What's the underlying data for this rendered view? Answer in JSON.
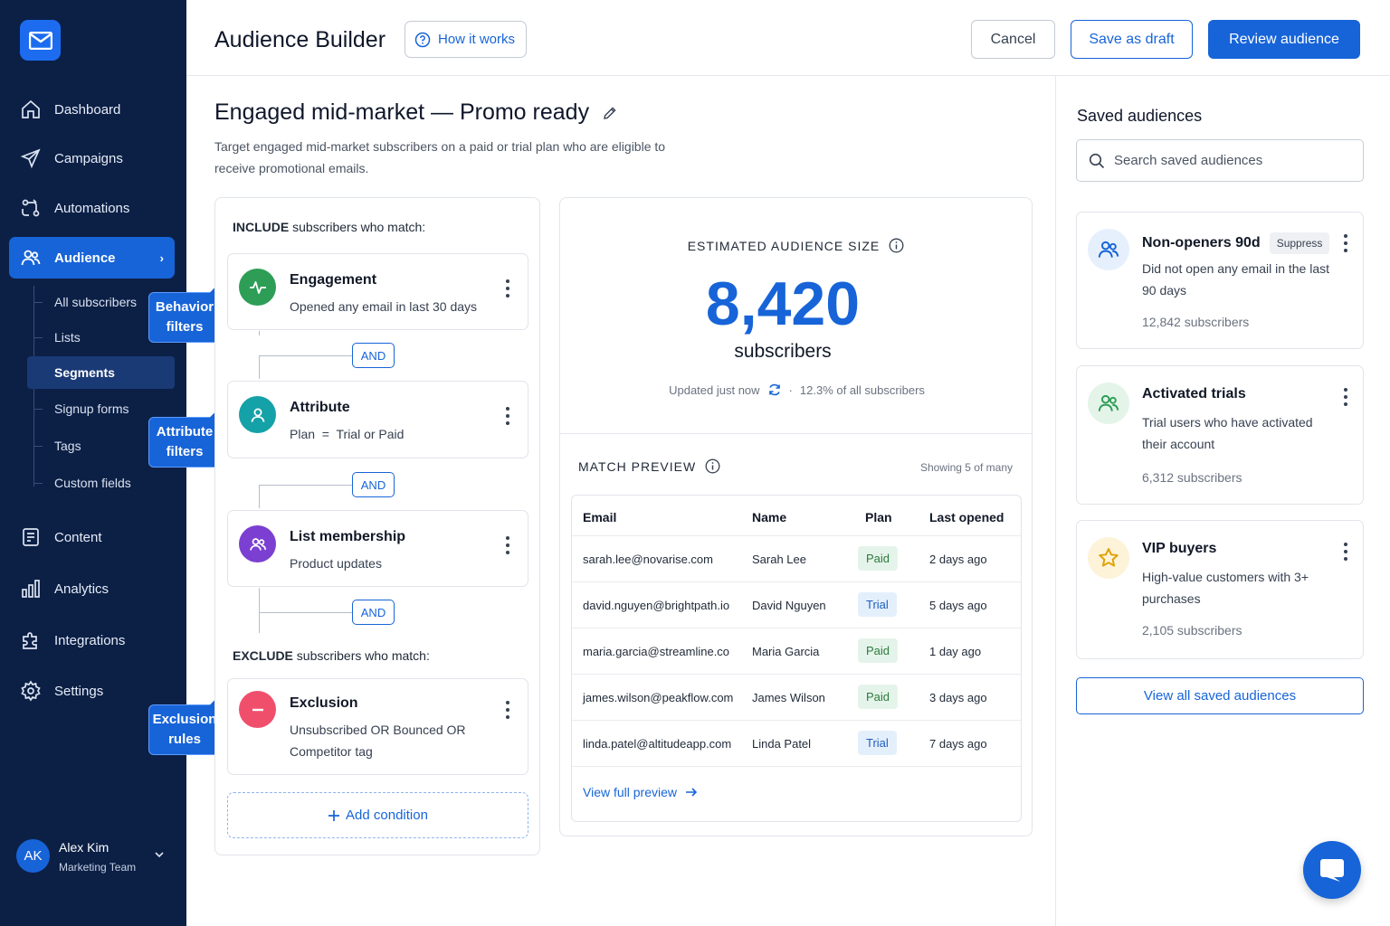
{
  "sidebar": {
    "nav": [
      {
        "label": "Dashboard",
        "icon": "home-icon"
      },
      {
        "label": "Campaigns",
        "icon": "send-icon"
      },
      {
        "label": "Automations",
        "icon": "automation-icon"
      },
      {
        "label": "Audience",
        "icon": "users-icon"
      },
      {
        "label": "Content",
        "icon": "document-icon"
      },
      {
        "label": "Analytics",
        "icon": "bar-chart-icon"
      },
      {
        "label": "Integrations",
        "icon": "puzzle-icon"
      },
      {
        "label": "Settings",
        "icon": "gear-icon"
      }
    ],
    "audience_sub": [
      "All subscribers",
      "Lists",
      "Segments",
      "Signup forms",
      "Tags",
      "Custom fields"
    ],
    "callouts": {
      "behavior": "Behavior filters",
      "attribute": "Attribute filters",
      "exclusion": "Exclusion rules"
    },
    "user": {
      "initials": "AK",
      "name": "Alex Kim",
      "team": "Marketing Team"
    }
  },
  "header": {
    "title": "Audience Builder",
    "how_it_works": "How it works",
    "cancel": "Cancel",
    "save_draft": "Save as draft",
    "review": "Review audience"
  },
  "segment": {
    "name": "Engaged mid-market — Promo ready",
    "description": "Target engaged mid-market subscribers on a paid or trial plan who are eligible to receive promotional emails."
  },
  "rules": {
    "include_label_bold": "INCLUDE",
    "include_label_rest": " subscribers who match:",
    "exclude_label_bold": "EXCLUDE",
    "exclude_label_rest": " subscribers who match:",
    "and_label": "AND",
    "include": [
      {
        "title": "Engagement",
        "desc": "Opened any email in last 30 days",
        "icon": "pulse-icon",
        "color": "#2e9e57"
      },
      {
        "title": "Attribute",
        "desc": "Plan  =  Trial or Paid",
        "icon": "person-icon",
        "color": "#15a1a8"
      },
      {
        "title": "List membership",
        "desc": "Product updates",
        "icon": "group-icon",
        "color": "#7b3fd1"
      }
    ],
    "exclude": [
      {
        "title": "Exclusion",
        "desc": "Unsubscribed OR Bounced OR Competitor tag",
        "icon": "minus-circle-icon",
        "color": "#f04f6c"
      }
    ],
    "add_condition": "Add condition"
  },
  "estimate": {
    "label": "ESTIMATED AUDIENCE SIZE",
    "value": "8,420",
    "unit": "subscribers",
    "updated": "Updated just now",
    "percent": "12.3% of all subscribers"
  },
  "preview": {
    "label": "MATCH PREVIEW",
    "showing": "Showing 5 of many",
    "columns": [
      "Email",
      "Name",
      "Plan",
      "Last opened"
    ],
    "rows": [
      {
        "email": "sarah.lee@novarise.com",
        "name": "Sarah Lee",
        "plan": "Paid",
        "last": "2 days ago"
      },
      {
        "email": "david.nguyen@brightpath.io",
        "name": "David Nguyen",
        "plan": "Trial",
        "last": "5 days ago"
      },
      {
        "email": "maria.garcia@streamline.co",
        "name": "Maria Garcia",
        "plan": "Paid",
        "last": "1 day ago"
      },
      {
        "email": "james.wilson@peakflow.com",
        "name": "James Wilson",
        "plan": "Paid",
        "last": "3 days ago"
      },
      {
        "email": "linda.patel@altitudeapp.com",
        "name": "Linda Patel",
        "plan": "Trial",
        "last": "7 days ago"
      }
    ],
    "view_full": "View full preview"
  },
  "saved": {
    "title": "Saved audiences",
    "search_placeholder": "Search saved audiences",
    "items": [
      {
        "name": "Non-openers 90d",
        "badge": "Suppress",
        "desc": "Did not open any email in the last 90 days",
        "count": "12,842 subscribers",
        "icon": "users-icon",
        "bg": "#e6f0fd",
        "fg": "#1764d8"
      },
      {
        "name": "Activated trials",
        "badge": "",
        "desc": "Trial users who have activated their account",
        "count": "6,312 subscribers",
        "icon": "users-icon",
        "bg": "#e4f4e9",
        "fg": "#2e9e57"
      },
      {
        "name": "VIP buyers",
        "badge": "",
        "desc": "High-value customers with 3+ purchases",
        "count": "2,105 subscribers",
        "icon": "star-icon",
        "bg": "#fdf3d9",
        "fg": "#e0a100"
      }
    ],
    "view_all": "View all saved audiences"
  },
  "colors": {
    "sidebar": "#0c2046",
    "accent": "#1764d8",
    "paid_bg": "#e5f4ea",
    "trial_bg": "#e4effc"
  }
}
